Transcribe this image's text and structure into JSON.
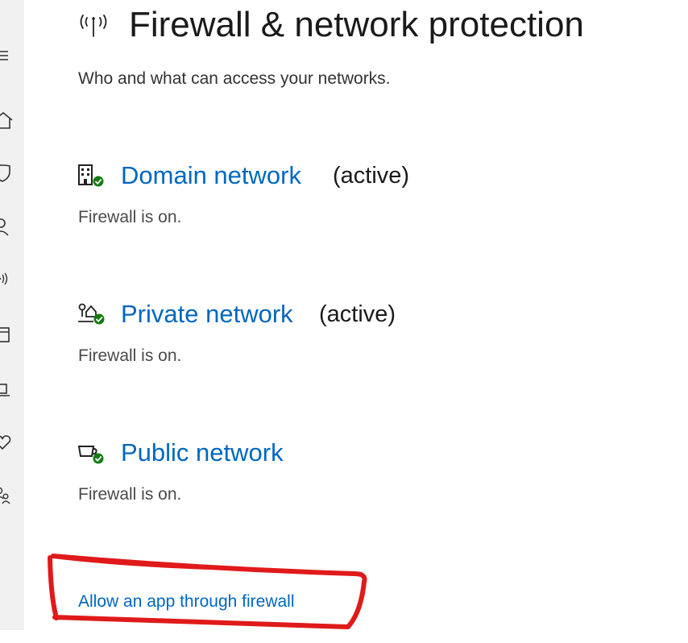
{
  "header": {
    "title": "Firewall & network protection",
    "subtitle": "Who and what can access your networks.",
    "icon": "wifi-antenna-icon"
  },
  "sidebar": {
    "items": [
      {
        "icon": "hamburger-menu-icon"
      },
      {
        "icon": "home-icon"
      },
      {
        "icon": "shield-icon"
      },
      {
        "icon": "person-icon"
      },
      {
        "icon": "wifi-antenna-icon"
      },
      {
        "icon": "app-browser-icon"
      },
      {
        "icon": "laptop-icon"
      },
      {
        "icon": "heart-icon"
      },
      {
        "icon": "family-icon"
      }
    ]
  },
  "networks": [
    {
      "name": "Domain network",
      "badge": "(active)",
      "status": "Firewall is on.",
      "icon": "building-icon",
      "status_color": "#107c10"
    },
    {
      "name": "Private network",
      "badge": "(active)",
      "status": "Firewall is on.",
      "icon": "home-network-icon",
      "status_color": "#107c10"
    },
    {
      "name": "Public network",
      "badge": "",
      "status": "Firewall is on.",
      "icon": "coffee-cup-icon",
      "status_color": "#107c10"
    }
  ],
  "links": {
    "allow_app": "Allow an app through firewall"
  },
  "colors": {
    "accent": "#0067c0",
    "ok_green": "#107c10",
    "annotation_red": "#e01a1a",
    "sidebar_bg": "#f1f1f1"
  }
}
